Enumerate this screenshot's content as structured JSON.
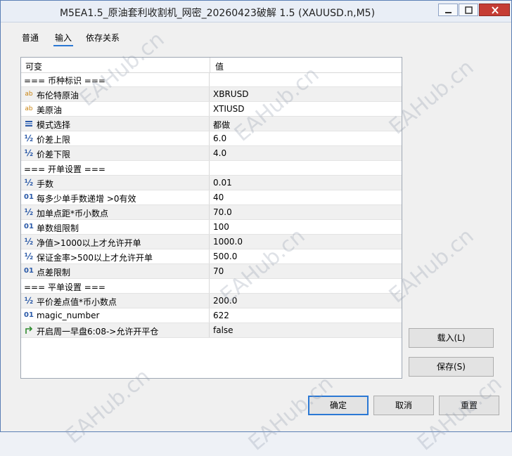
{
  "window": {
    "title": "M5EA1.5_原油套利收割机_网密_20260423破解 1.5 (XAUUSD.n,M5)"
  },
  "tabs": [
    {
      "label": "普通"
    },
    {
      "label": "输入"
    },
    {
      "label": "依存关系"
    }
  ],
  "table": {
    "headers": {
      "variable": "可变",
      "value": "值"
    },
    "rows": [
      {
        "icon": "section",
        "name": "=== 币种标识 ===",
        "value": ""
      },
      {
        "icon": "ab-string-icon",
        "name": "布伦特原油",
        "value": "XBRUSD"
      },
      {
        "icon": "ab-string-icon",
        "name": "美原油",
        "value": "XTIUSD"
      },
      {
        "icon": "enum-list-icon",
        "name": "模式选择",
        "value": "都做"
      },
      {
        "icon": "half-double-icon",
        "name": "价差上限",
        "value": "6.0"
      },
      {
        "icon": "half-double-icon",
        "name": "价差下限",
        "value": "4.0"
      },
      {
        "icon": "section",
        "name": "=== 开单设置 ===",
        "value": ""
      },
      {
        "icon": "half-double-icon",
        "name": "手数",
        "value": "0.01"
      },
      {
        "icon": "int-icon",
        "name": "每多少单手数递增 >0有效",
        "value": "40"
      },
      {
        "icon": "half-double-icon",
        "name": "加单点距*币小数点",
        "value": "70.0"
      },
      {
        "icon": "int-icon",
        "name": "单数组限制",
        "value": "100"
      },
      {
        "icon": "half-double-icon",
        "name": "净值>1000以上才允许开单",
        "value": "1000.0"
      },
      {
        "icon": "half-double-icon",
        "name": "保证金率>500以上才允许开单",
        "value": "500.0"
      },
      {
        "icon": "int-icon",
        "name": "点差限制",
        "value": "70"
      },
      {
        "icon": "section",
        "name": "=== 平单设置 ===",
        "value": ""
      },
      {
        "icon": "half-double-icon",
        "name": "平价差点值*币小数点",
        "value": "200.0"
      },
      {
        "icon": "int-icon",
        "name": "magic_number",
        "value": "622"
      },
      {
        "icon": "bool-arrow-icon",
        "name": "开启周一早盘6:08->允许开平仓",
        "value": "false"
      }
    ]
  },
  "buttons": {
    "load": "载入(L)",
    "save": "保存(S)",
    "ok": "确定",
    "cancel": "取消",
    "reset": "重置"
  },
  "watermark": "EAHub.cn",
  "colors": {
    "accent": "#2b78d4",
    "close": "#c53d35"
  }
}
